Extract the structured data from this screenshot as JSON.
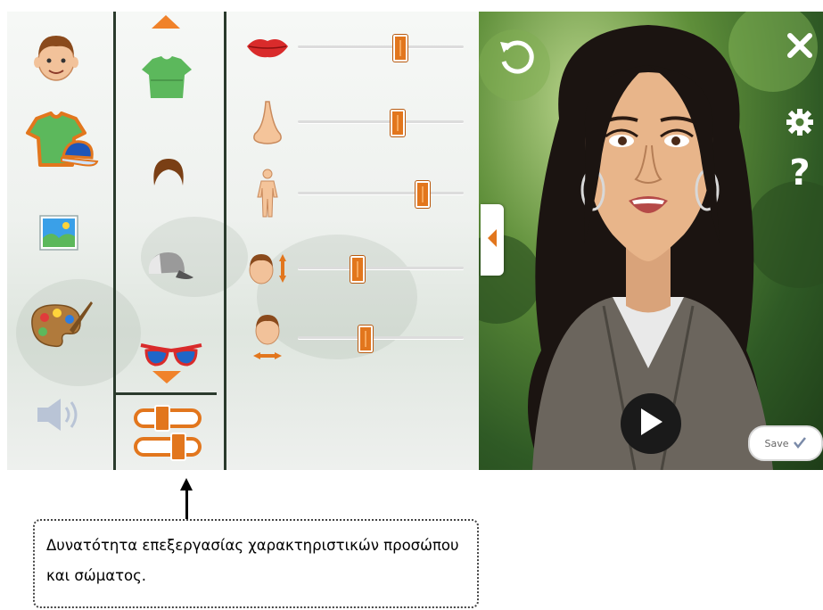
{
  "categories": [
    {
      "name": "avatar-head",
      "icon": "boy-face-icon"
    },
    {
      "name": "clothes-and-accessories",
      "icon": "shirt-cap-icon"
    },
    {
      "name": "background",
      "icon": "landscape-picture-icon"
    },
    {
      "name": "colors",
      "icon": "paint-palette-icon"
    },
    {
      "name": "sound",
      "icon": "speaker-icon"
    }
  ],
  "subcategories": [
    {
      "name": "scroll-up",
      "icon": "orange-up-arrow-icon"
    },
    {
      "name": "shirt",
      "icon": "green-tshirt-icon"
    },
    {
      "name": "hair",
      "icon": "brown-hair-icon"
    },
    {
      "name": "hat",
      "icon": "grey-cap-icon"
    },
    {
      "name": "glasses",
      "icon": "red-sunglasses-icon"
    },
    {
      "name": "scroll-down",
      "icon": "orange-down-arrow-icon"
    },
    {
      "name": "sliders",
      "icon": "orange-sliders-icon",
      "selected": true
    }
  ],
  "feature_sliders": [
    {
      "feature": "mouth",
      "icon": "lips-icon",
      "level": 0.62
    },
    {
      "feature": "nose",
      "icon": "nose-icon",
      "level": 0.6
    },
    {
      "feature": "body",
      "icon": "human-body-icon",
      "level": 0.75
    },
    {
      "feature": "head-height",
      "icon": "head-vertical-size-icon",
      "level": 0.36
    },
    {
      "feature": "head-width",
      "icon": "head-horizontal-size-icon",
      "level": 0.41
    }
  ],
  "preview": {
    "save_label": "Save",
    "icons": [
      "reset-icon",
      "close-icon",
      "gear-icon",
      "help-icon",
      "play-icon",
      "collapse-left-icon",
      "checkmark-icon"
    ]
  },
  "help_mark": "?",
  "callout": {
    "text": "Δυνατότητα επεξεργασίας χαρακτηριστικών προσώπου και σώματος."
  },
  "colors": {
    "accent_orange": "#e2761d",
    "divider": "#2a3a2c",
    "preview_green": "#3f6f2f"
  }
}
